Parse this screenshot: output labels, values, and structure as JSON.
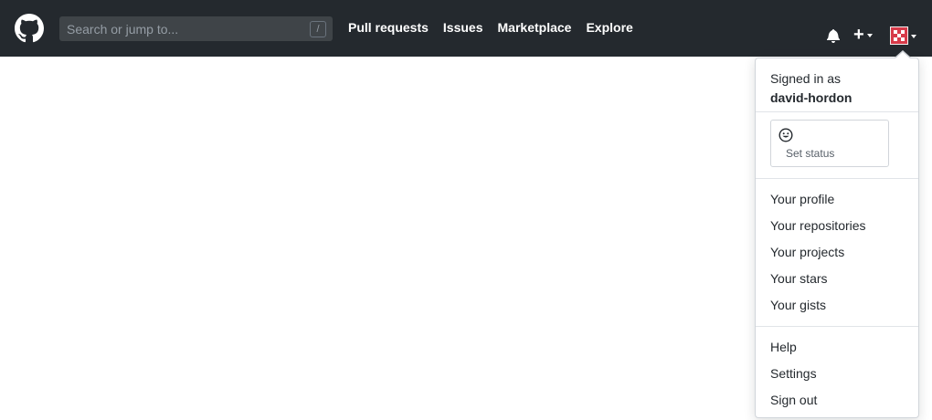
{
  "header": {
    "search": {
      "placeholder": "Search or jump to...",
      "shortcut": "/"
    },
    "nav": [
      "Pull requests",
      "Issues",
      "Marketplace",
      "Explore"
    ],
    "plus_label": "+"
  },
  "dropdown": {
    "signed_in_label": "Signed in as",
    "username": "david-hordon",
    "set_status": "Set status",
    "profile_items": [
      "Your profile",
      "Your repositories",
      "Your projects",
      "Your stars",
      "Your gists"
    ],
    "account_items": [
      "Help",
      "Settings",
      "Sign out"
    ]
  },
  "colors": {
    "header_bg": "#24292e",
    "avatar": "#d73a49"
  }
}
